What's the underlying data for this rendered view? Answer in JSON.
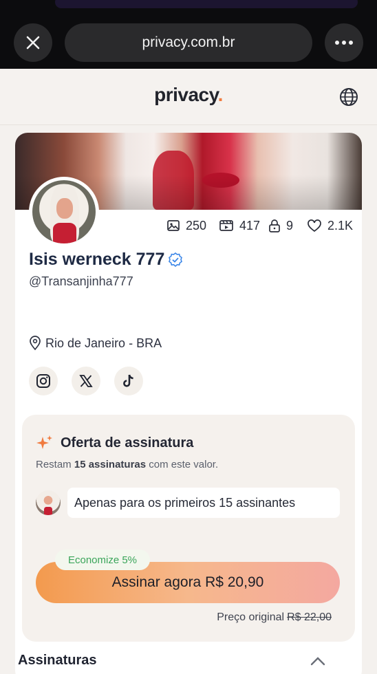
{
  "browser": {
    "url": "privacy.com.br",
    "close_icon": "close-icon",
    "more_icon": "more-horizontal-icon"
  },
  "header": {
    "logo_text": "privacy",
    "logo_dot": ".",
    "globe_icon": "globe-icon",
    "accent_color": "#f07b3f"
  },
  "profile": {
    "stats": [
      {
        "icon": "image-icon",
        "value": "250"
      },
      {
        "icon": "video-icon",
        "value": "417"
      },
      {
        "icon": "lock-icon",
        "value": "9"
      },
      {
        "icon": "heart-icon",
        "value": "2.1K"
      }
    ],
    "name": "Isis werneck 777",
    "verified_icon": "verified-badge-icon",
    "handle": "@Transanjinha777",
    "location": "Rio de Janeiro - BRA",
    "socials": [
      "instagram-icon",
      "x-icon",
      "tiktok-icon"
    ]
  },
  "offer": {
    "title": "Oferta de assinatura",
    "sub_prefix": "Restam ",
    "sub_bold": "15 assinaturas",
    "sub_suffix": " com este valor.",
    "bubble_text": "Apenas para os primeiros 15 assinantes",
    "save_badge": "Economize 5%",
    "button_label": "Assinar agora R$ 20,90",
    "original_label": "Preço original",
    "original_price": "R$ 22,00",
    "save_color": "#3aa55a"
  },
  "sections": {
    "subscriptions_title": "Assinaturas"
  }
}
